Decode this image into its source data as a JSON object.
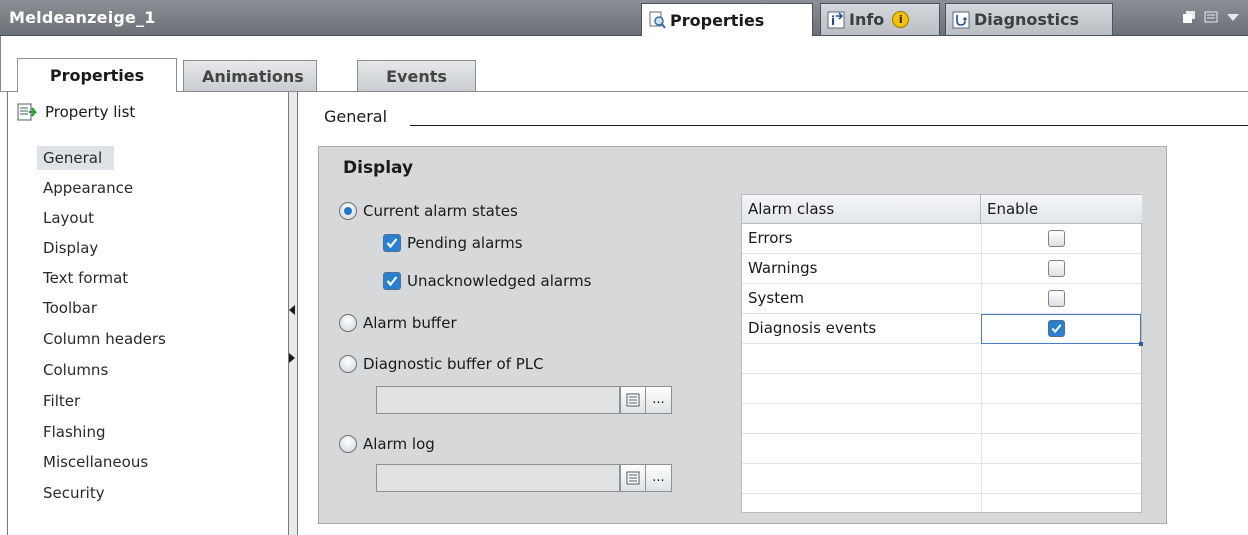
{
  "window": {
    "title": "Meldeanzeige_1",
    "tabs": [
      {
        "label": "Properties",
        "icon": "magnifier-page-icon"
      },
      {
        "label": "Info",
        "icon": "info-arrow-icon",
        "badge": "i"
      },
      {
        "label": "Diagnostics",
        "icon": "diagnostics-icon"
      }
    ],
    "controls": [
      "restore-icon",
      "menu-list-icon",
      "dropdown-arrow-icon"
    ]
  },
  "subtabs": [
    {
      "label": "Properties",
      "active": true
    },
    {
      "label": "Animations",
      "active": false
    },
    {
      "label": "Events",
      "active": false
    }
  ],
  "sidebar": {
    "header": "Property list",
    "items": [
      {
        "label": "General",
        "selected": true
      },
      {
        "label": "Appearance"
      },
      {
        "label": "Layout"
      },
      {
        "label": "Display"
      },
      {
        "label": "Text format"
      },
      {
        "label": "Toolbar"
      },
      {
        "label": "Column headers"
      },
      {
        "label": "Columns"
      },
      {
        "label": "Filter"
      },
      {
        "label": "Flashing"
      },
      {
        "label": "Miscellaneous"
      },
      {
        "label": "Security"
      }
    ]
  },
  "main": {
    "section": "General",
    "group_title": "Display",
    "options": {
      "current_alarm_states": {
        "label": "Current alarm states",
        "checked": true
      },
      "pending_alarms": {
        "label": "Pending alarms",
        "checked": true
      },
      "unacknowledged_alarms": {
        "label": "Unacknowledged alarms",
        "checked": true
      },
      "alarm_buffer": {
        "label": "Alarm buffer",
        "checked": false
      },
      "diagnostic_buffer": {
        "label": "Diagnostic buffer of PLC",
        "checked": false,
        "value": ""
      },
      "alarm_log": {
        "label": "Alarm log",
        "checked": false,
        "value": ""
      },
      "browse_label": "..."
    },
    "alarm_table": {
      "columns": [
        "Alarm class",
        "Enable"
      ],
      "rows": [
        {
          "class": "Errors",
          "enabled": false
        },
        {
          "class": "Warnings",
          "enabled": false
        },
        {
          "class": "System",
          "enabled": false
        },
        {
          "class": "Diagnosis events",
          "enabled": true
        }
      ]
    }
  },
  "colors": {
    "accent": "#2a80d0",
    "titlebar": "#7a8086",
    "group_bg": "#d6d8da"
  }
}
